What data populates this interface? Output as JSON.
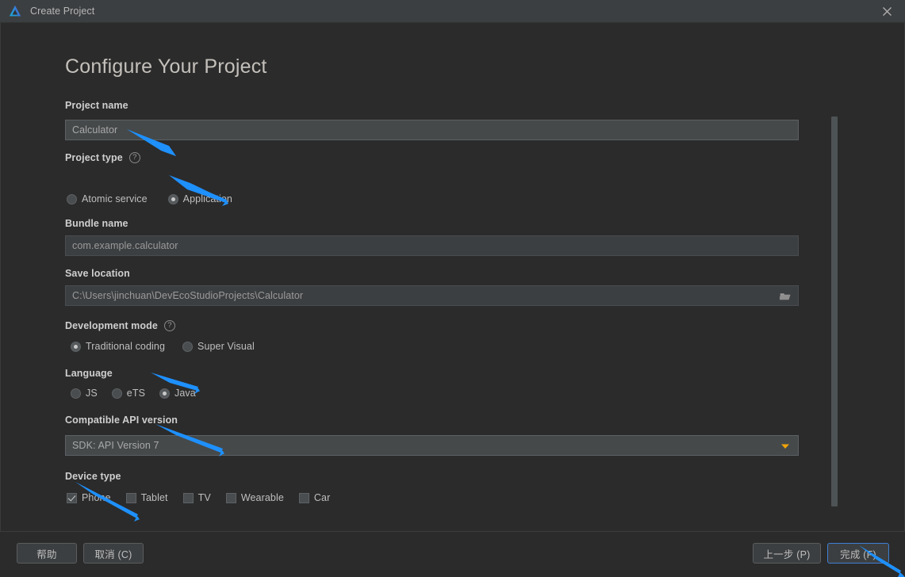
{
  "window": {
    "title": "Create Project",
    "logo_icon": "deveco-studio-logo-icon",
    "close_icon": "close-icon"
  },
  "page": {
    "title": "Configure Your Project"
  },
  "fields": {
    "project_name": {
      "label": "Project name",
      "value": "Calculator"
    },
    "project_type": {
      "label": "Project type",
      "help_icon": "help-icon",
      "help_glyph": "?",
      "options": [
        {
          "label": "Atomic service",
          "checked": false
        },
        {
          "label": "Application",
          "checked": true
        }
      ]
    },
    "bundle_name": {
      "label": "Bundle name",
      "value": "com.example.calculator"
    },
    "save_location": {
      "label": "Save location",
      "value": "C:\\Users\\jinchuan\\DevEcoStudioProjects\\Calculator",
      "browse_icon": "folder-icon"
    },
    "development_mode": {
      "label": "Development mode",
      "help_icon": "help-icon",
      "help_glyph": "?",
      "options": [
        {
          "label": "Traditional coding",
          "checked": true
        },
        {
          "label": "Super Visual",
          "checked": false
        }
      ]
    },
    "language": {
      "label": "Language",
      "options": [
        {
          "label": "JS",
          "checked": false
        },
        {
          "label": "eTS",
          "checked": false
        },
        {
          "label": "Java",
          "checked": true
        }
      ]
    },
    "compatible_api_version": {
      "label": "Compatible API version",
      "value": "SDK: API Version 7",
      "dropdown_icon": "chevron-down-icon"
    },
    "device_type": {
      "label": "Device type",
      "options": [
        {
          "label": "Phone",
          "checked": true
        },
        {
          "label": "Tablet",
          "checked": false
        },
        {
          "label": "TV",
          "checked": false
        },
        {
          "label": "Wearable",
          "checked": false
        },
        {
          "label": "Car",
          "checked": false
        }
      ]
    }
  },
  "footer": {
    "help": "帮助",
    "cancel": "取消 (C)",
    "previous": "上一步 (P)",
    "finish": "完成 (F)"
  },
  "colors": {
    "window_bg": "#2b2b2b",
    "titlebar_bg": "#3c3f41",
    "input_bg": "#3c3f41",
    "input_focused_bg": "#45494a",
    "accent_blue": "#1e90ff",
    "dropdown_arrow": "#f0a30a",
    "default_button_border": "#3f7fd4",
    "text_primary": "#cfcfcf",
    "text_muted": "#9a9a9a"
  },
  "annotations": {
    "arrow_color": "#1e90ff",
    "arrows": [
      {
        "name": "arrow-to-project-name"
      },
      {
        "name": "arrow-to-application-radio"
      },
      {
        "name": "arrow-to-java-radio"
      },
      {
        "name": "arrow-to-api-version"
      },
      {
        "name": "arrow-to-phone-checkbox"
      },
      {
        "name": "arrow-to-finish-button"
      }
    ]
  }
}
